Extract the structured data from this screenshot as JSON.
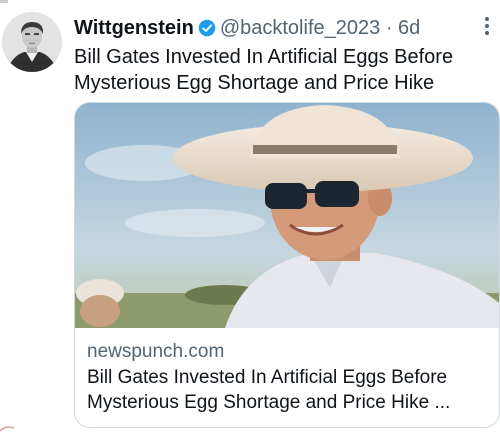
{
  "tweet": {
    "author_name": "Wittgenstein",
    "handle": "@backtolife_2023",
    "separator": "·",
    "time": "6d",
    "text_line1": "Bill Gates Invested In Artificial Eggs Before",
    "text_line2": "Mysterious Egg Shortage and Price Hike"
  },
  "card": {
    "domain": "newspunch.com",
    "title_line1": "Bill Gates Invested In Artificial Eggs Before",
    "title_line2": "Mysterious Egg Shortage and Price Hike ..."
  },
  "colors": {
    "verified_blue": "#1d9bf0",
    "secondary_text": "#536471",
    "primary_text": "#0f1419",
    "border": "#cfd9de"
  },
  "icons": {
    "verified": "verified-badge-icon",
    "more": "more-icon"
  }
}
